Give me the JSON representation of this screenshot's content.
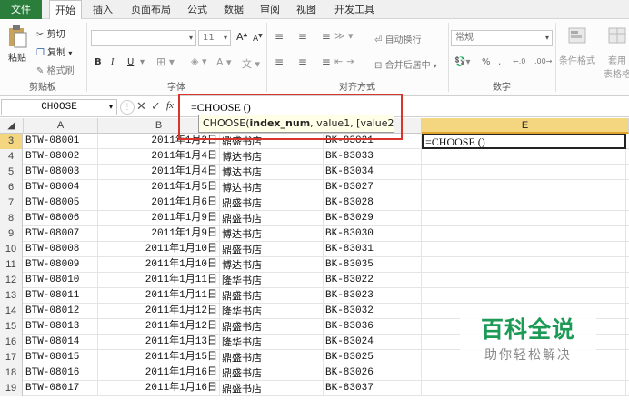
{
  "tabs": [
    "文件",
    "开始",
    "插入",
    "页面布局",
    "公式",
    "数据",
    "审阅",
    "视图",
    "开发工具"
  ],
  "ribbon": {
    "clipboard": {
      "paste": "粘贴",
      "cut": "剪切",
      "copy": "复制",
      "format_painter": "格式刷",
      "label": "剪贴板"
    },
    "font": {
      "size": "11",
      "label": "字体",
      "bold": "B",
      "italic": "I",
      "underline": "U",
      "grow": "A",
      "shrink": "A"
    },
    "align": {
      "wrap": "自动换行",
      "merge": "合并后居中",
      "label": "对齐方式"
    },
    "number": {
      "format": "常规",
      "percent": "%",
      "label": "数字"
    },
    "styles": {
      "conditional": "条件格式",
      "table": "套用",
      "table2": "表格格"
    }
  },
  "formula_bar": {
    "name_box": "CHOOSE",
    "fx": "fx",
    "formula": "=CHOOSE ()"
  },
  "tooltip": {
    "func": "CHOOSE(",
    "arg1": "index_num",
    "rest": ", value1, [value2], ...)"
  },
  "columns": [
    "A",
    "B",
    "C",
    "D",
    "E"
  ],
  "active_cell": {
    "ref": "E3",
    "text": "=CHOOSE ()"
  },
  "rows": [
    {
      "n": "3",
      "a": "BTW-08001",
      "b": "2011年1月2日",
      "c": "鼎盛书店",
      "d": "BK-83021"
    },
    {
      "n": "4",
      "a": "BTW-08002",
      "b": "2011年1月4日",
      "c": "博达书店",
      "d": "BK-83033"
    },
    {
      "n": "5",
      "a": "BTW-08003",
      "b": "2011年1月4日",
      "c": "博达书店",
      "d": "BK-83034"
    },
    {
      "n": "6",
      "a": "BTW-08004",
      "b": "2011年1月5日",
      "c": "博达书店",
      "d": "BK-83027"
    },
    {
      "n": "7",
      "a": "BTW-08005",
      "b": "2011年1月6日",
      "c": "鼎盛书店",
      "d": "BK-83028"
    },
    {
      "n": "8",
      "a": "BTW-08006",
      "b": "2011年1月9日",
      "c": "鼎盛书店",
      "d": "BK-83029"
    },
    {
      "n": "9",
      "a": "BTW-08007",
      "b": "2011年1月9日",
      "c": "博达书店",
      "d": "BK-83030"
    },
    {
      "n": "10",
      "a": "BTW-08008",
      "b": "2011年1月10日",
      "c": "鼎盛书店",
      "d": "BK-83031"
    },
    {
      "n": "11",
      "a": "BTW-08009",
      "b": "2011年1月10日",
      "c": "博达书店",
      "d": "BK-83035"
    },
    {
      "n": "12",
      "a": "BTW-08010",
      "b": "2011年1月11日",
      "c": "隆华书店",
      "d": "BK-83022"
    },
    {
      "n": "13",
      "a": "BTW-08011",
      "b": "2011年1月11日",
      "c": "鼎盛书店",
      "d": "BK-83023"
    },
    {
      "n": "14",
      "a": "BTW-08012",
      "b": "2011年1月12日",
      "c": "隆华书店",
      "d": "BK-83032"
    },
    {
      "n": "15",
      "a": "BTW-08013",
      "b": "2011年1月12日",
      "c": "鼎盛书店",
      "d": "BK-83036"
    },
    {
      "n": "16",
      "a": "BTW-08014",
      "b": "2011年1月13日",
      "c": "隆华书店",
      "d": "BK-83024"
    },
    {
      "n": "17",
      "a": "BTW-08015",
      "b": "2011年1月15日",
      "c": "鼎盛书店",
      "d": "BK-83025"
    },
    {
      "n": "18",
      "a": "BTW-08016",
      "b": "2011年1月16日",
      "c": "鼎盛书店",
      "d": "BK-83026"
    },
    {
      "n": "19",
      "a": "BTW-08017",
      "b": "2011年1月16日",
      "c": "鼎盛书店",
      "d": "BK-83037"
    }
  ],
  "watermark": {
    "title": "百科全说",
    "subtitle": "助你轻松解决"
  },
  "colors": {
    "file_tab": "#2a7d3b",
    "selected_header": "#f4d681",
    "highlight_box": "#d9352a",
    "watermark": "#1d9b56"
  }
}
